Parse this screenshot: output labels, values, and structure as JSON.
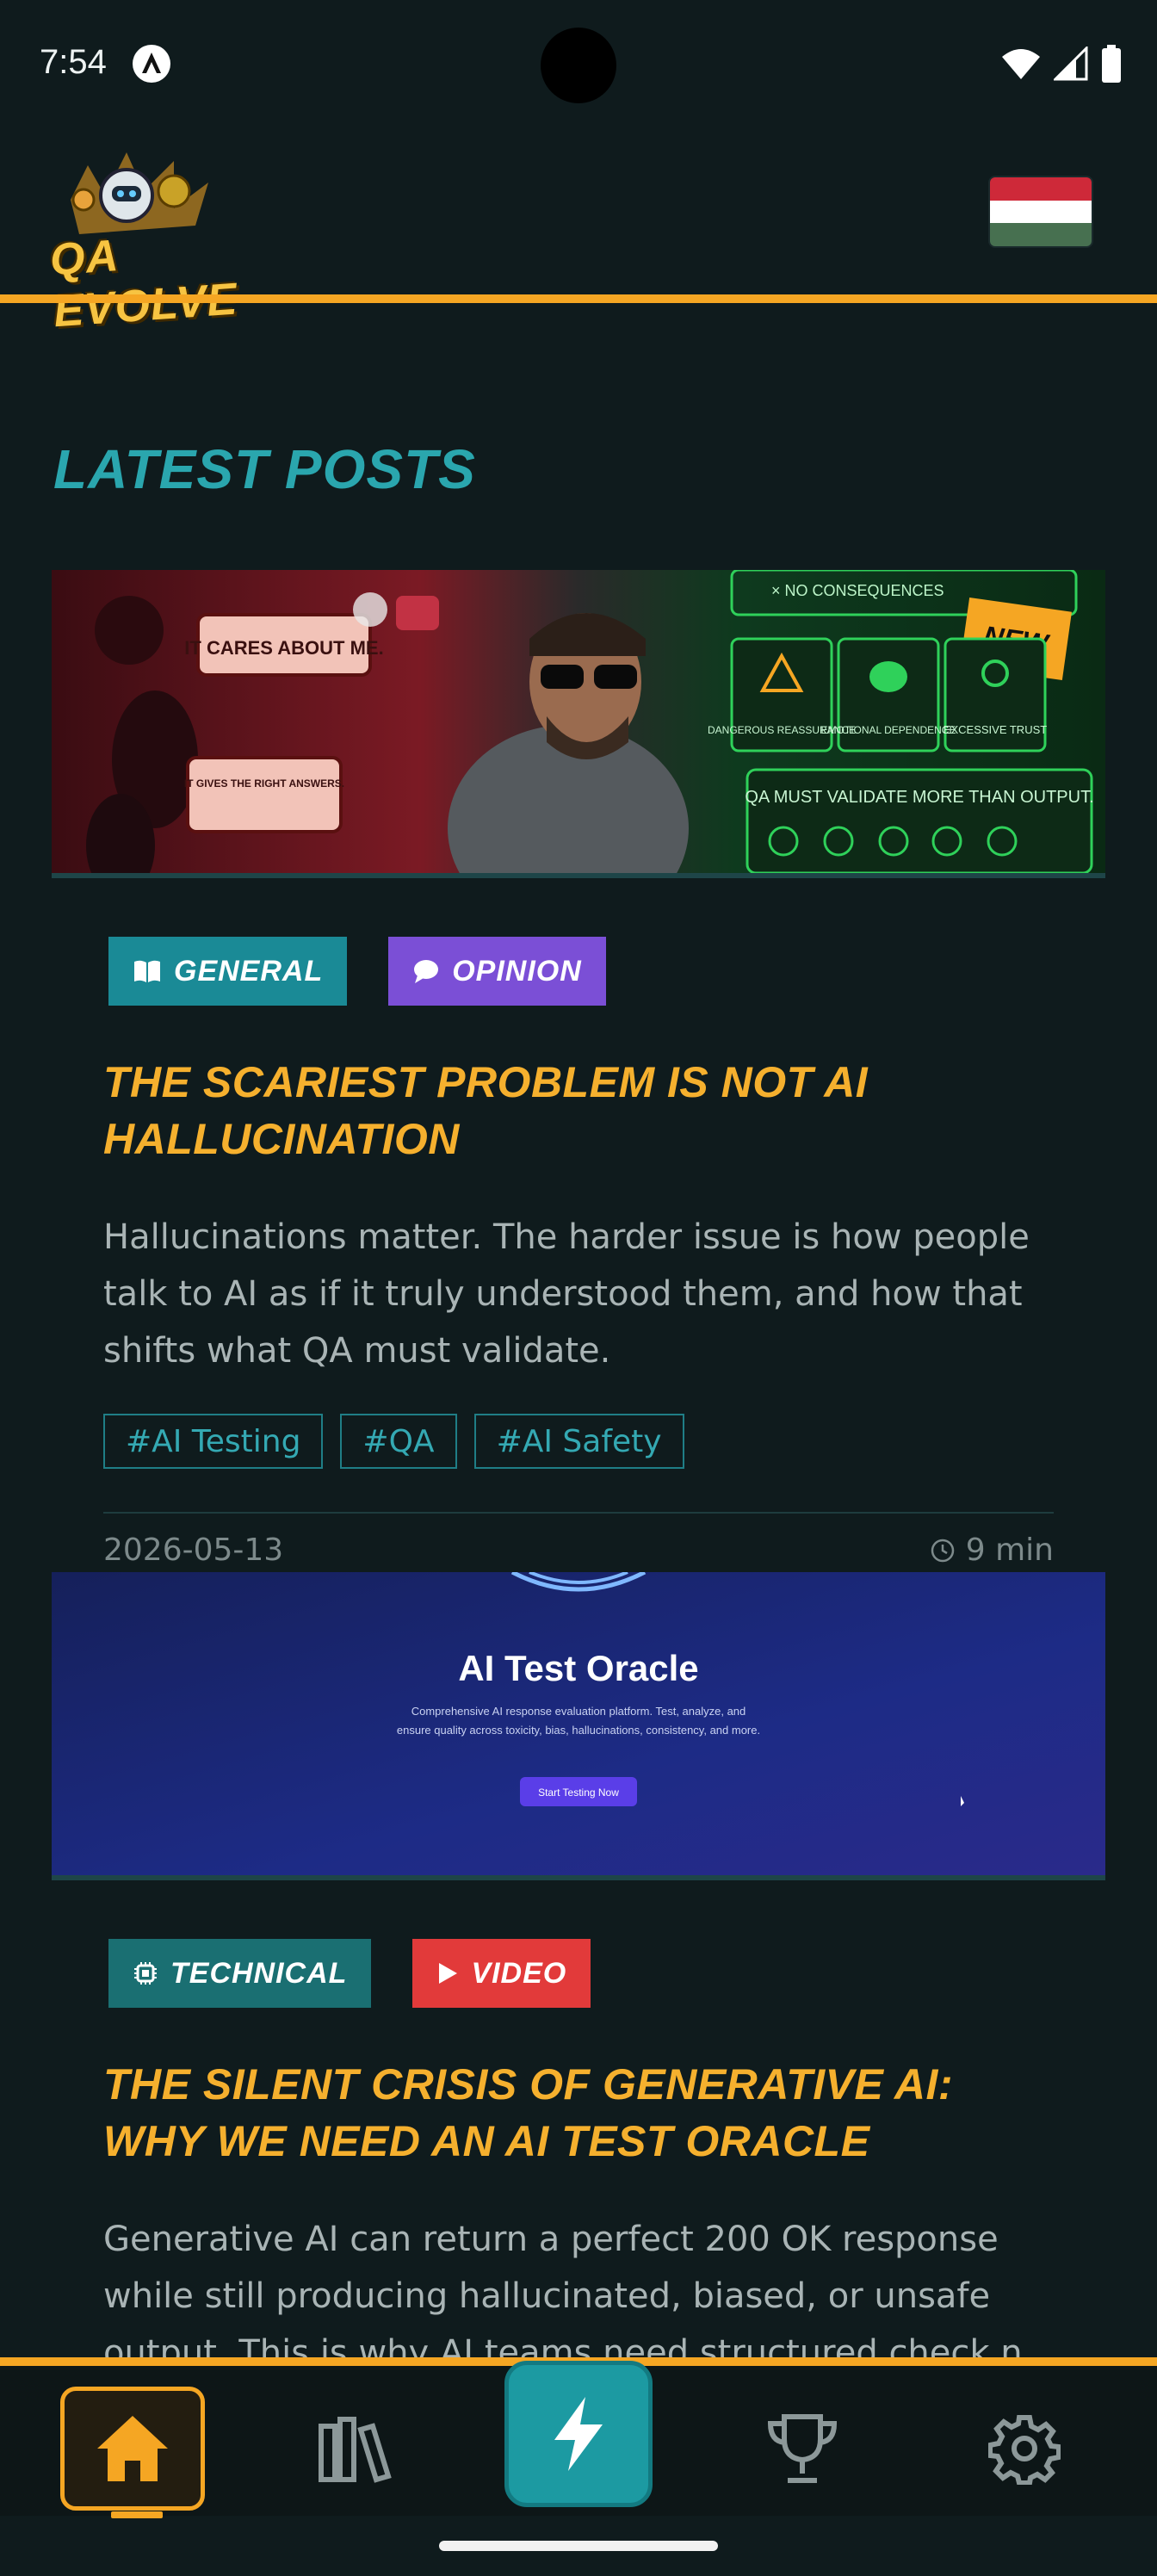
{
  "status_bar": {
    "time": "7:54"
  },
  "header": {
    "logo_text": "QA EVOLVE",
    "flag_colors": [
      "#ce2939",
      "#ffffff",
      "#477050"
    ]
  },
  "section": {
    "title": "LATEST POSTS"
  },
  "posts": [
    {
      "image_caption": {
        "speech1": "IT CARES ABOUT ME.",
        "speech2": "IT GIVES THE RIGHT ANSWERS.",
        "badge": "NEW",
        "box1": "DANGEROUS REASSURANCE",
        "box2": "EMOTIONAL DEPENDENCE",
        "box3": "EXCESSIVE TRUST",
        "line_top": "× NO CONSEQUENCES",
        "banner": "QA MUST VALIDATE MORE THAN OUTPUT."
      },
      "chips": [
        {
          "label": "GENERAL",
          "icon": "book-icon"
        },
        {
          "label": "OPINION",
          "icon": "speech-bubble-icon"
        }
      ],
      "title": "THE SCARIEST PROBLEM IS NOT AI HALLUCINATION",
      "excerpt": "Hallucinations matter. The harder issue is how people talk to AI as if it truly understood them, and how that shifts what QA must validate.",
      "tags": [
        "#AI Testing",
        "#QA",
        "#AI Safety"
      ],
      "date": "2026-05-13",
      "read_time": "9 min"
    },
    {
      "image_caption": {
        "heading": "AI Test Oracle",
        "sub1": "Comprehensive AI response evaluation platform. Test, analyze, and",
        "sub2": "ensure quality across toxicity, bias, hallucinations, consistency, and more.",
        "cta": "Start Testing Now"
      },
      "chips": [
        {
          "label": "TECHNICAL",
          "icon": "chip-icon"
        },
        {
          "label": "VIDEO",
          "icon": "play-icon"
        }
      ],
      "title": "THE SILENT CRISIS OF GENERATIVE AI: WHY WE NEED AN AI TEST ORACLE",
      "excerpt": "Generative AI can return a perfect 200 OK response while still producing hallucinated, biased, or unsafe output. This is why AI teams need structured check n"
    }
  ],
  "nav": {
    "items": [
      {
        "name": "home",
        "icon": "home-icon",
        "active": true
      },
      {
        "name": "library",
        "icon": "library-icon"
      },
      {
        "name": "quick",
        "icon": "lightning-icon"
      },
      {
        "name": "achievements",
        "icon": "trophy-icon"
      },
      {
        "name": "settings",
        "icon": "gear-icon"
      }
    ],
    "accent": "#f5a623",
    "quick_color": "#1c9aa2"
  }
}
